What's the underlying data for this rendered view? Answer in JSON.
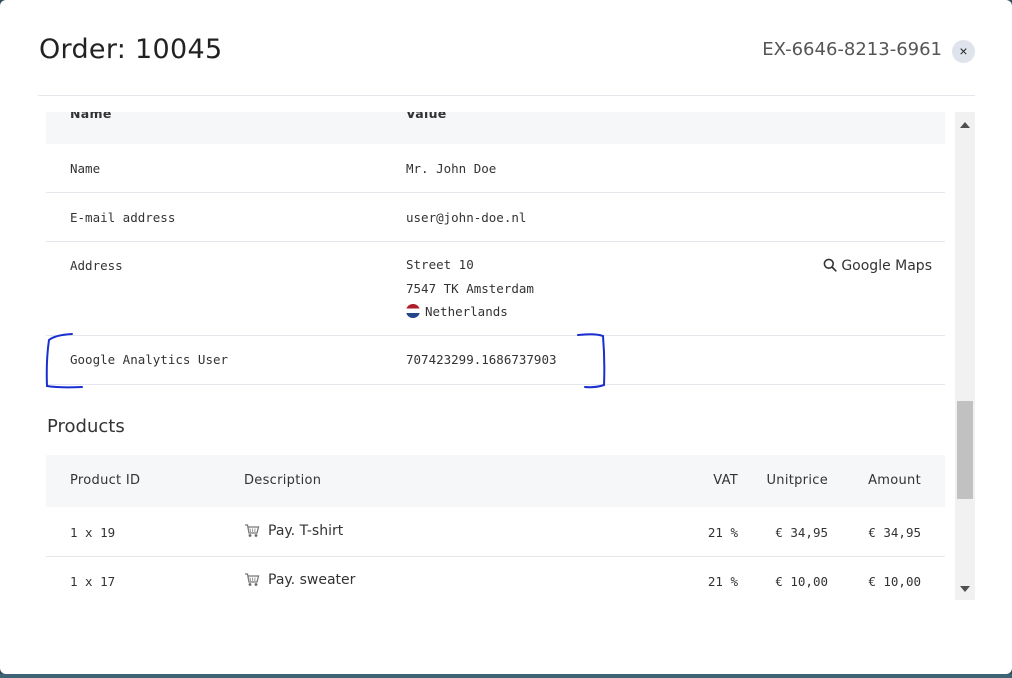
{
  "modal": {
    "title": "Order: 10045",
    "order_reference": "EX-6646-8213-6961",
    "close_label": "×"
  },
  "customer": {
    "headers": {
      "name": "Name",
      "value": "Value"
    },
    "rows": {
      "name": {
        "label": "Name",
        "value": "Mr. John Doe"
      },
      "email": {
        "label": "E-mail address",
        "value": "user@john-doe.nl"
      },
      "address": {
        "label": "Address",
        "street": "Street 10",
        "city": "7547 TK Amsterdam",
        "country": "Netherlands",
        "maps_link": "Google Maps"
      },
      "ga_user": {
        "label": "Google Analytics User",
        "value": "707423299.1686737903"
      }
    }
  },
  "products": {
    "title": "Products",
    "headers": {
      "id": "Product ID",
      "description": "Description",
      "vat": "VAT",
      "unitprice": "Unitprice",
      "amount": "Amount"
    },
    "rows": [
      {
        "id": "1 x 19",
        "description": "Pay. T-shirt",
        "vat": "21 %",
        "unitprice": "€ 34,95",
        "amount": "€ 34,95"
      },
      {
        "id": "1 x 17",
        "description": "Pay. sweater",
        "vat": "21 %",
        "unitprice": "€ 10,00",
        "amount": "€ 10,00"
      }
    ]
  },
  "icons": {
    "close": "close-icon",
    "search": "search-icon",
    "flag": "netherlands-flag-icon",
    "cart": "shopping-cart-icon"
  },
  "colors": {
    "annotation": "#1a2fd0",
    "flag_red": "#ae1c28",
    "flag_blue": "#21468b"
  }
}
